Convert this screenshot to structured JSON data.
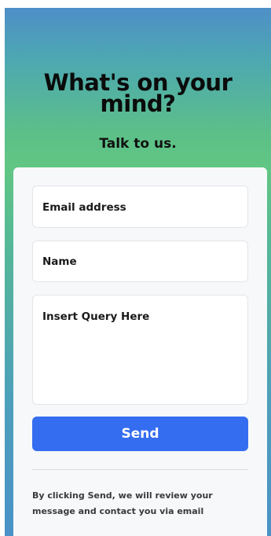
{
  "header": {
    "title_line1": "What's on your",
    "title_line2": "mind?",
    "subtitle": "Talk to us."
  },
  "form": {
    "email_placeholder": "Email address",
    "name_placeholder": "Name",
    "query_placeholder": "Insert Query Here",
    "send_label": "Send",
    "disclaimer_line1": "By clicking Send, we will review your",
    "disclaimer_line2": "message and contact you via email"
  },
  "colors": {
    "accent": "#356df1",
    "gradient_top": "#4e8fc8",
    "gradient_mid": "#61c683",
    "card": "#f7f8fa"
  }
}
